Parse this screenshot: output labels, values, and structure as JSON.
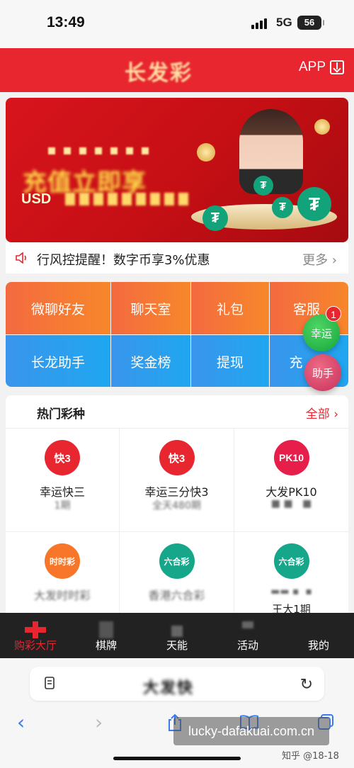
{
  "status_bar": {
    "time": "13:49",
    "network": "5G",
    "battery": "56"
  },
  "header": {
    "logo_text": "长发彩",
    "app_label": "APP",
    "download_icon": "download-icon"
  },
  "banner": {
    "currency": "USD",
    "headline_blurred": "充值立即享",
    "colors": {
      "background": "#d8141c",
      "accent": "#ffe14a",
      "tether": "#13a37a"
    }
  },
  "notice": {
    "text": "行风控提醒！数字币享3%优惠",
    "more_label": "更多",
    "icon": "speaker-icon"
  },
  "menu": {
    "items": [
      {
        "label": "微聊好友"
      },
      {
        "label": "聊天室"
      },
      {
        "label": "礼包"
      },
      {
        "label": "客服"
      },
      {
        "label": "长龙助手"
      },
      {
        "label": "奖金榜"
      },
      {
        "label": "提现"
      },
      {
        "label": "充"
      }
    ]
  },
  "floating": {
    "lucky_label": "幸运",
    "badge_count": "1",
    "helper_label": "助手"
  },
  "hot_lottery": {
    "title": "热门彩种",
    "all_label": "全部",
    "items": [
      {
        "name": "幸运快三",
        "issue": "1期",
        "logo": "快3",
        "color": "#e8262f"
      },
      {
        "name": "幸运三分快3",
        "issue": "全天480期",
        "logo": "快3",
        "color": "#e8262f"
      },
      {
        "name": "大发PK10",
        "issue": "",
        "logo": "PK10",
        "color": "#e81e4a"
      },
      {
        "name": "大发时时彩",
        "issue": "",
        "logo": "时时彩",
        "color": "#f7762a"
      },
      {
        "name": "香港六合彩",
        "issue": "",
        "logo": "六合彩",
        "color": "#16a68a"
      },
      {
        "name": "",
        "issue": "王大1期",
        "logo": "六合彩",
        "color": "#16a68a"
      }
    ]
  },
  "bottom_nav": {
    "tabs": [
      {
        "label": "购彩大厅",
        "active": true
      },
      {
        "label": "棋牌",
        "active": false
      },
      {
        "label": "天能",
        "active": false
      },
      {
        "label": "活动",
        "active": false
      },
      {
        "label": "我的",
        "active": false
      }
    ]
  },
  "browser": {
    "url_blurred": "大发快",
    "watermark": "lucky-dafakuai.com.cn",
    "credit": "知乎 @18-18"
  }
}
